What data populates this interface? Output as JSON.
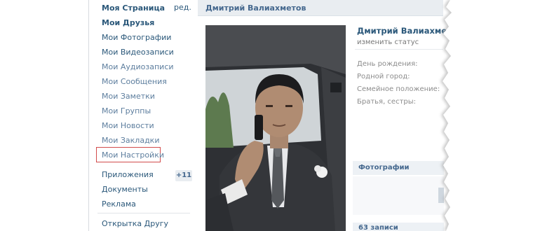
{
  "sidebar": {
    "edit_label": "ред.",
    "items": [
      {
        "label": "Моя Страница"
      },
      {
        "label": "Мои Друзья"
      },
      {
        "label": "Мои Фотографии"
      },
      {
        "label": "Мои Видеозаписи"
      },
      {
        "label": "Мои Аудиозаписи"
      },
      {
        "label": "Мои Сообщения"
      },
      {
        "label": "Мои Заметки"
      },
      {
        "label": "Мои Группы"
      },
      {
        "label": "Мои Новости"
      },
      {
        "label": "Мои Закладки"
      },
      {
        "label": "Мои Настройки"
      }
    ],
    "apps_label": "Приложения",
    "apps_badge": "+11",
    "docs_label": "Документы",
    "ads_label": "Реклама",
    "postcard_label": "Открытка Другу"
  },
  "header": {
    "title": "Дмитрий Валиахметов"
  },
  "profile": {
    "name": "Дмитрий Валиахмет",
    "status_link": "изменить статус",
    "info": [
      {
        "label": "День рождения:"
      },
      {
        "label": "Родной город:"
      },
      {
        "label": "Семейное положение:"
      },
      {
        "label": "Братья, сестры:"
      }
    ],
    "photos_title": "Фотографии",
    "wall_count": "63 записи"
  },
  "colors": {
    "link": "#2b587a",
    "header_bg": "#e9edf1",
    "highlight_border": "#d24b4b"
  }
}
